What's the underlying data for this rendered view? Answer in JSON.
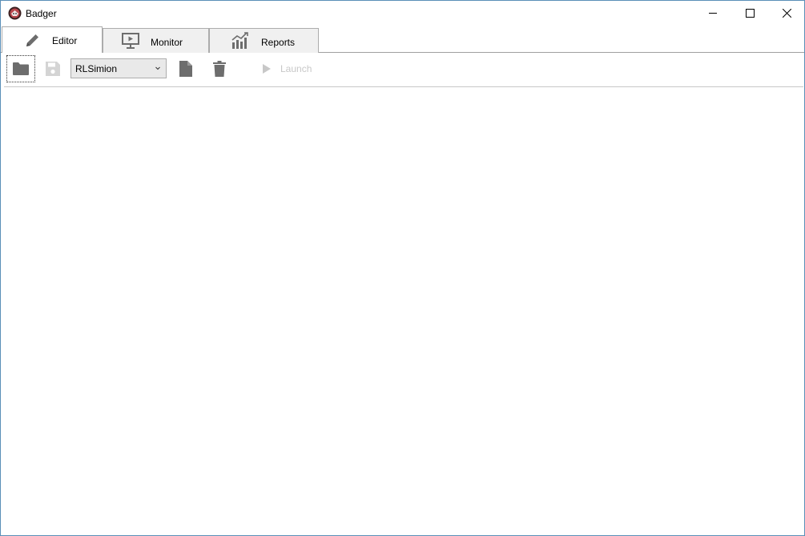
{
  "window": {
    "title": "Badger",
    "app_icon": "badger-logo-icon",
    "controls": {
      "minimize_icon": "minimize-icon",
      "maximize_icon": "maximize-icon",
      "close_icon": "close-icon"
    }
  },
  "tabs": [
    {
      "label": "Editor",
      "icon": "pencil-icon",
      "active": true
    },
    {
      "label": "Monitor",
      "icon": "monitor-play-icon",
      "active": false
    },
    {
      "label": "Reports",
      "icon": "bar-chart-icon",
      "active": false
    }
  ],
  "toolbar": {
    "open_icon": "folder-icon",
    "save_icon": "save-icon",
    "combo": {
      "selected": "RLSimion"
    },
    "new_icon": "file-icon",
    "delete_icon": "trash-icon",
    "launch": {
      "label": "Launch",
      "icon": "play-icon",
      "enabled": false
    }
  },
  "colors": {
    "icon": "#6d6d6d",
    "icon_disabled": "#c8c8c8",
    "window_border": "#5a8fb8",
    "tab_inactive_bg": "#f0f0f0"
  }
}
